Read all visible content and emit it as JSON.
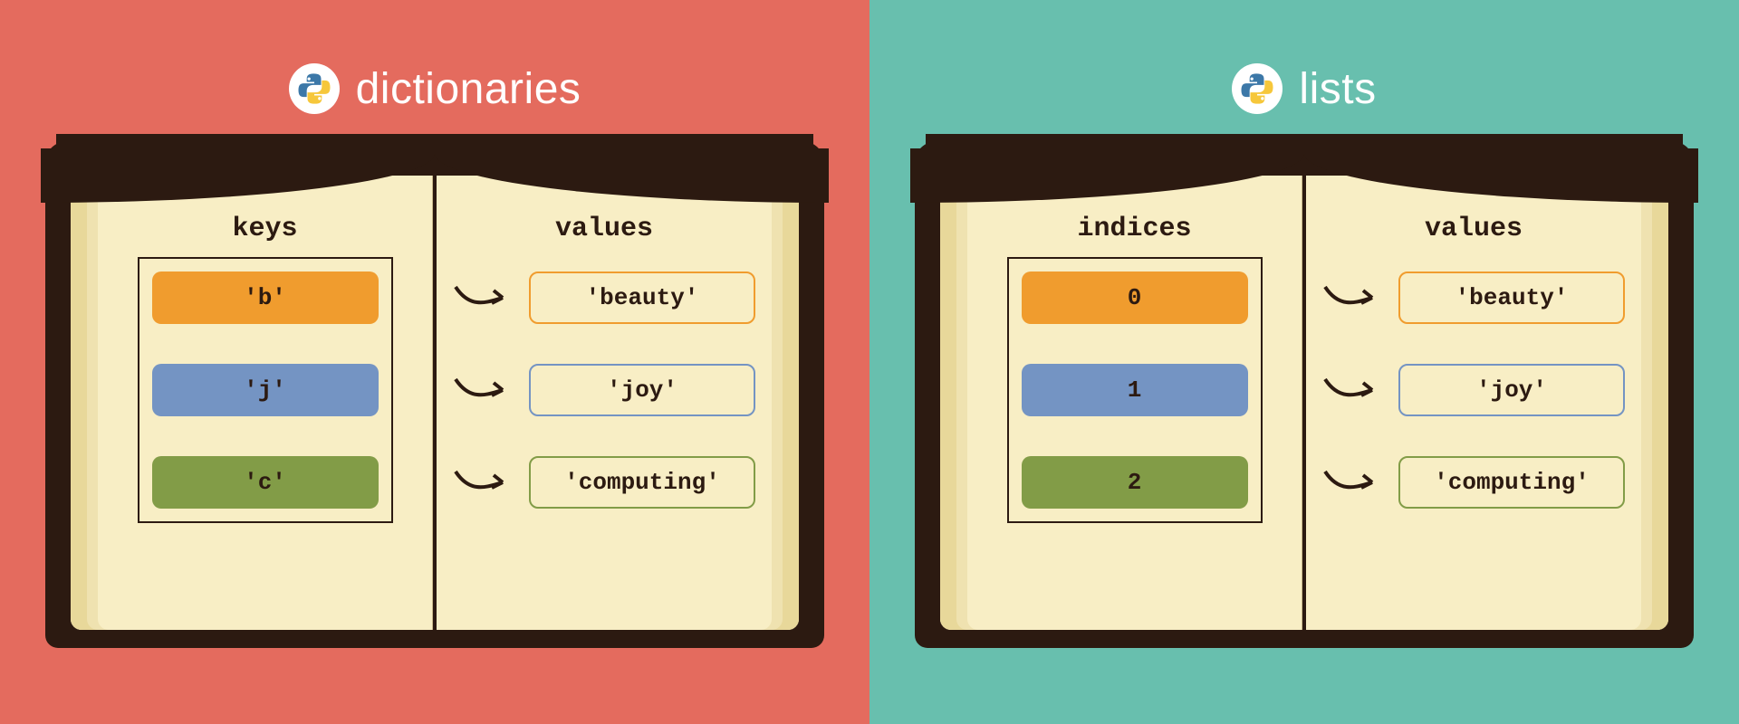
{
  "left": {
    "title": "dictionaries",
    "keys_heading": "keys",
    "values_heading": "values",
    "rows": [
      {
        "key": "'b'",
        "value": "'beauty'",
        "color": "orange"
      },
      {
        "key": "'j'",
        "value": "'joy'",
        "color": "blue"
      },
      {
        "key": "'c'",
        "value": "'computing'",
        "color": "green"
      }
    ]
  },
  "right": {
    "title": "lists",
    "keys_heading": "indices",
    "values_heading": "values",
    "rows": [
      {
        "key": "0",
        "value": "'beauty'",
        "color": "orange"
      },
      {
        "key": "1",
        "value": "'joy'",
        "color": "blue"
      },
      {
        "key": "2",
        "value": "'computing'",
        "color": "green"
      }
    ]
  },
  "icon_name": "python-logo-icon",
  "colors": {
    "left_bg": "#E46B5E",
    "right_bg": "#68BFAE",
    "orange": "#F09C2E",
    "blue": "#7494C3",
    "green": "#829C47",
    "book_cover": "#2C1A11",
    "page": "#F8EEC5"
  }
}
